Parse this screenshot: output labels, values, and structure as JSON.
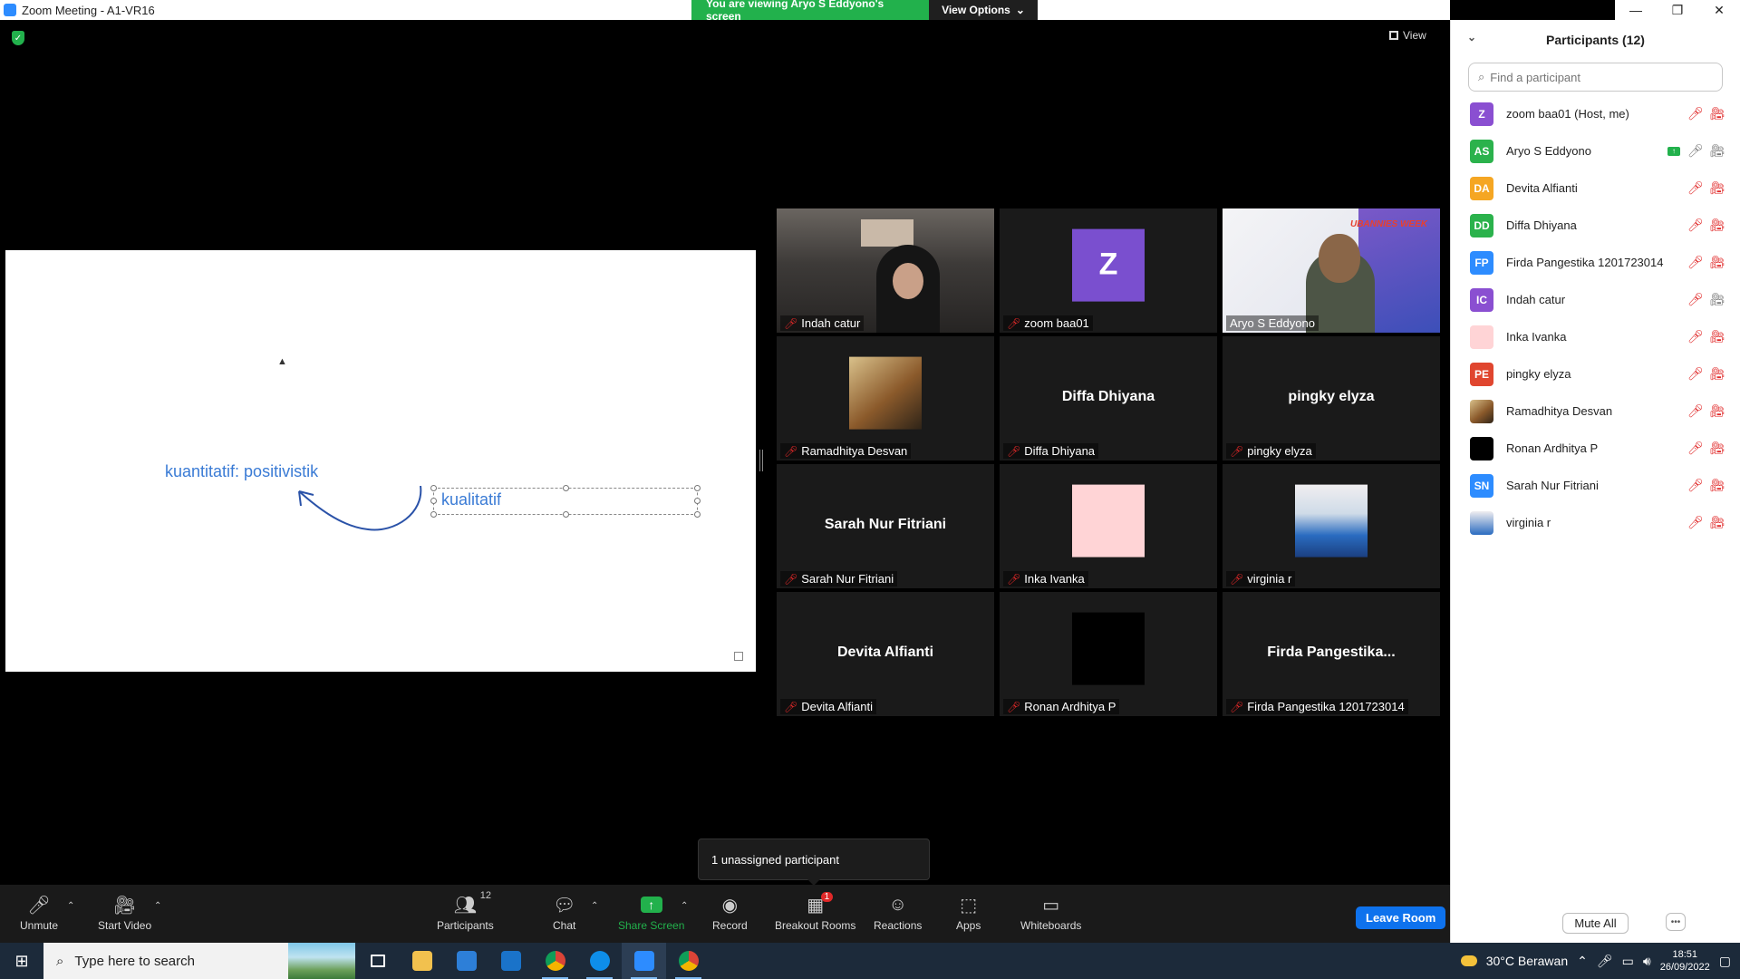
{
  "window": {
    "title": "Zoom Meeting - A1-VR16",
    "viewing_banner": "You are viewing Aryo S Eddyono's screen",
    "view_options": "View Options",
    "minimize": "—",
    "restore": "❐",
    "close": "✕"
  },
  "meeting": {
    "view_label": "View",
    "toast": "1 unassigned participant"
  },
  "whiteboard": {
    "text1": "kuantitatif: positivistik",
    "text2": "kualitatif"
  },
  "gallery": {
    "tiles": [
      {
        "name": "Indah catur"
      },
      {
        "name": "zoom baa01",
        "avatar_letter": "Z",
        "avatar_color": "#7a4fcf"
      },
      {
        "name": "Aryo S Eddyono",
        "logo": "UBANNIES WEEK"
      },
      {
        "name": "Ramadhitya Desvan"
      },
      {
        "name": "Diffa Dhiyana",
        "big": "Diffa Dhiyana"
      },
      {
        "name": "pingky elyza",
        "big": "pingky elyza"
      },
      {
        "name": "Sarah Nur Fitriani",
        "big": "Sarah Nur Fitriani"
      },
      {
        "name": "Inka Ivanka",
        "avatar_color": "#ffd4d6"
      },
      {
        "name": "virginia r"
      },
      {
        "name": "Devita Alfianti",
        "big": "Devita Alfianti"
      },
      {
        "name": "Ronan Ardhitya P",
        "avatar_color": "#000000"
      },
      {
        "name": "Firda Pangestika 1201723014",
        "big": "Firda  Pangestika..."
      }
    ]
  },
  "panel": {
    "title": "Participants (12)",
    "search_placeholder": "Find a participant",
    "mute_all": "Mute All",
    "more": "•••",
    "participants": [
      {
        "initials": "Z",
        "color": "#8a4fd1",
        "name": "zoom baa01 (Host, me)"
      },
      {
        "initials": "AS",
        "color": "#2bb24c",
        "name": "Aryo S Eddyono"
      },
      {
        "initials": "DA",
        "color": "#f5a623",
        "name": "Devita Alfianti"
      },
      {
        "initials": "DD",
        "color": "#2bb24c",
        "name": "Diffa Dhiyana"
      },
      {
        "initials": "FP",
        "color": "#2d8cff",
        "name": "Firda Pangestika 1201723014"
      },
      {
        "initials": "IC",
        "color": "#8a4fd1",
        "name": "Indah catur"
      },
      {
        "initials": "",
        "color": "#ffd4d6",
        "name": "Inka Ivanka"
      },
      {
        "initials": "PE",
        "color": "#e0462f",
        "name": "pingky elyza"
      },
      {
        "initials": "",
        "color": "#8b5a2b",
        "name": "Ramadhitya Desvan"
      },
      {
        "initials": "",
        "color": "#000000",
        "name": "Ronan Ardhitya P"
      },
      {
        "initials": "SN",
        "color": "#2d8cff",
        "name": "Sarah Nur Fitriani"
      },
      {
        "initials": "",
        "color": "#3a6fb8",
        "name": "virginia r"
      }
    ]
  },
  "toolbar": {
    "unmute": "Unmute",
    "start_video": "Start Video",
    "participants": "Participants",
    "participants_count": "12",
    "chat": "Chat",
    "share_screen": "Share Screen",
    "record": "Record",
    "breakout_rooms": "Breakout Rooms",
    "breakout_badge": "1",
    "reactions": "Reactions",
    "apps": "Apps",
    "whiteboards": "Whiteboards",
    "leave_room": "Leave Room"
  },
  "taskbar": {
    "search_placeholder": "Type here to search",
    "weather": "30°C  Berawan",
    "time": "18:51",
    "date": "26/09/2022"
  },
  "colors": {
    "zoom_blue": "#0e72ed",
    "share_green": "#22b14c",
    "muted_red": "#e02828",
    "active_speaker": "#e9e95a"
  }
}
